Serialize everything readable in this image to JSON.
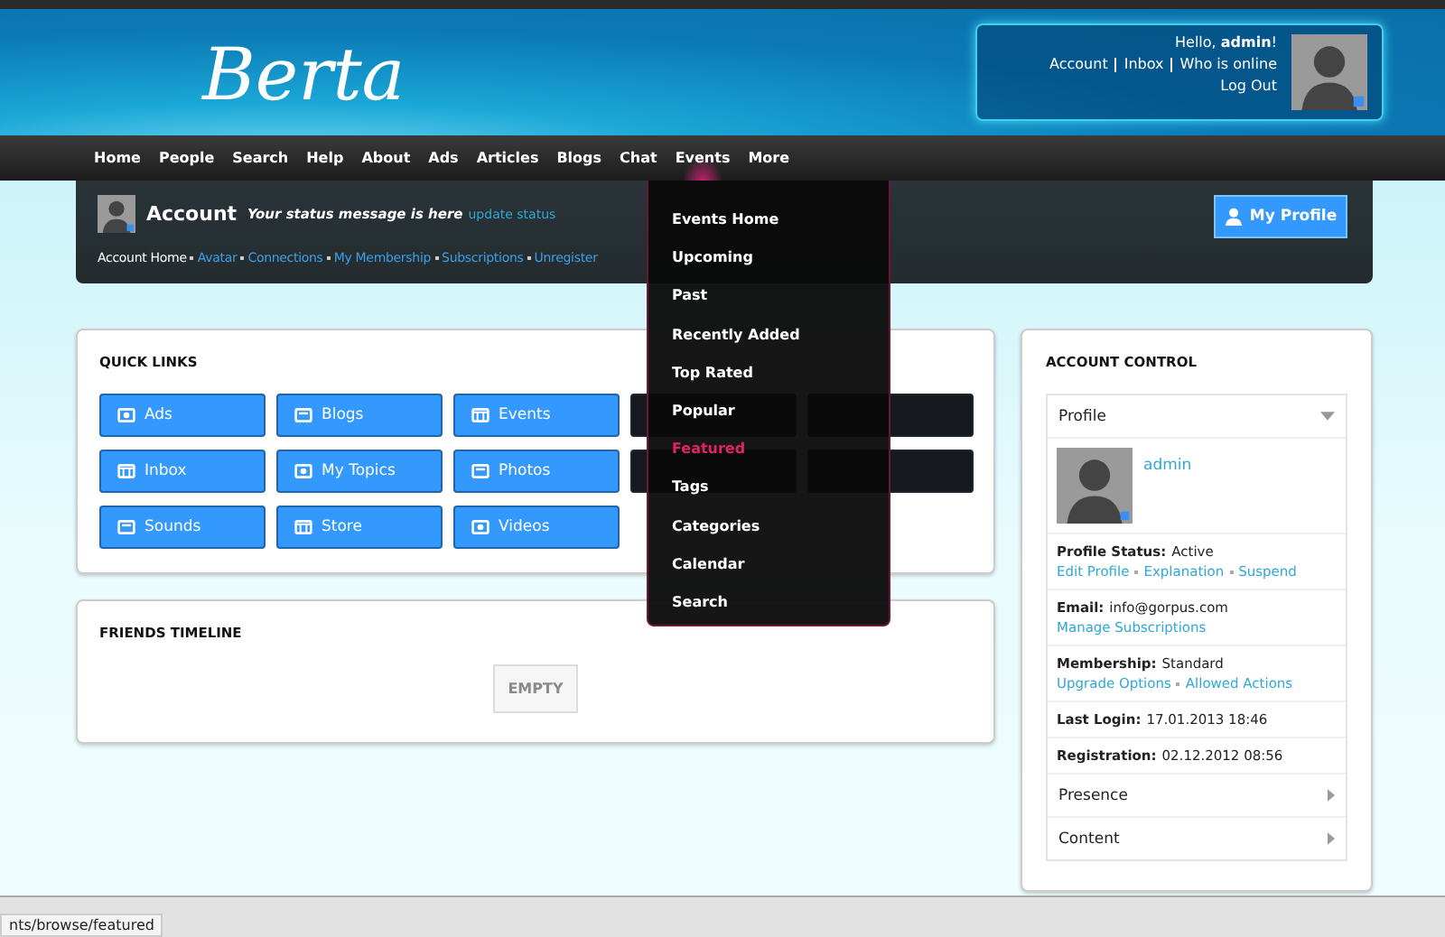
{
  "header": {
    "logo": "Berta",
    "greeting": "Hello, **admin**!",
    "user_links": [
      "Account",
      "Inbox",
      "Who is online"
    ],
    "logout": "Log Out"
  },
  "nav": [
    {
      "label": "Home",
      "selected": false
    },
    {
      "label": "People",
      "selected": false
    },
    {
      "label": "Search",
      "selected": false
    },
    {
      "label": "Help",
      "selected": false
    },
    {
      "label": "About",
      "selected": false
    },
    {
      "label": "Ads",
      "selected": false
    },
    {
      "label": "Articles",
      "selected": false
    },
    {
      "label": "Blogs",
      "selected": false
    },
    {
      "label": "Chat",
      "selected": false
    },
    {
      "label": "Events",
      "selected": true
    },
    {
      "label": "More",
      "selected": false
    }
  ],
  "events_menu": [
    {
      "label": "Events Home",
      "selected": false
    },
    {
      "label": "Upcoming",
      "selected": false
    },
    {
      "label": "Past",
      "selected": false
    },
    {
      "label": "Recently Added",
      "selected": false
    },
    {
      "label": "Top Rated",
      "selected": false
    },
    {
      "label": "Popular",
      "selected": false
    },
    {
      "label": "Featured",
      "selected": true
    },
    {
      "label": "Tags",
      "selected": false
    },
    {
      "label": "Categories",
      "selected": false
    },
    {
      "label": "Calendar",
      "selected": false
    },
    {
      "label": "Search",
      "selected": false
    }
  ],
  "account": {
    "title": "Account",
    "status": "Your status message is here",
    "update": "update status",
    "links": [
      "Account Home",
      "Avatar",
      "Connections",
      "My Membership",
      "Subscriptions",
      "Unregister"
    ],
    "profile_button": "My Profile"
  },
  "quick_links": {
    "title": "QUICK LINKS",
    "items": [
      {
        "label": "Ads",
        "dimmed": false
      },
      {
        "label": "Blogs",
        "dimmed": false
      },
      {
        "label": "Events",
        "dimmed": false
      },
      {
        "dimmed": true
      },
      {
        "dimmed": true
      },
      {
        "label": "Inbox",
        "dimmed": false
      },
      {
        "label": "My Topics",
        "dimmed": false
      },
      {
        "label": "Photos",
        "dimmed": false
      },
      {
        "dimmed": true
      },
      {
        "dimmed": true
      },
      {
        "label": "Sounds",
        "dimmed": false
      },
      {
        "label": "Store",
        "dimmed": false
      },
      {
        "label": "Videos",
        "dimmed": false
      }
    ]
  },
  "friends_timeline": {
    "title": "FRIENDS TIMELINE",
    "empty": "EMPTY"
  },
  "account_control": {
    "title": "ACCOUNT CONTROL",
    "profile_section": "Profile",
    "username": "admin",
    "rows": [
      {
        "label": "Profile Status:",
        "value": "Active",
        "links": [
          "Edit Profile",
          "Explanation",
          "Suspend"
        ]
      },
      {
        "label": "Email:",
        "value": "info@gorpus.com",
        "links": [
          "Manage Subscriptions"
        ]
      },
      {
        "label": "Membership:",
        "value": "Standard",
        "links": [
          "Upgrade Options",
          "Allowed Actions"
        ]
      },
      {
        "label": "Last Login:",
        "value": "17.01.2013 18:46",
        "links": []
      },
      {
        "label": "Registration:",
        "value": "02.12.2012 08:56",
        "links": []
      }
    ],
    "sections": [
      "Presence",
      "Content"
    ]
  },
  "status_bar": {
    "url": "nts/browse/featured"
  }
}
